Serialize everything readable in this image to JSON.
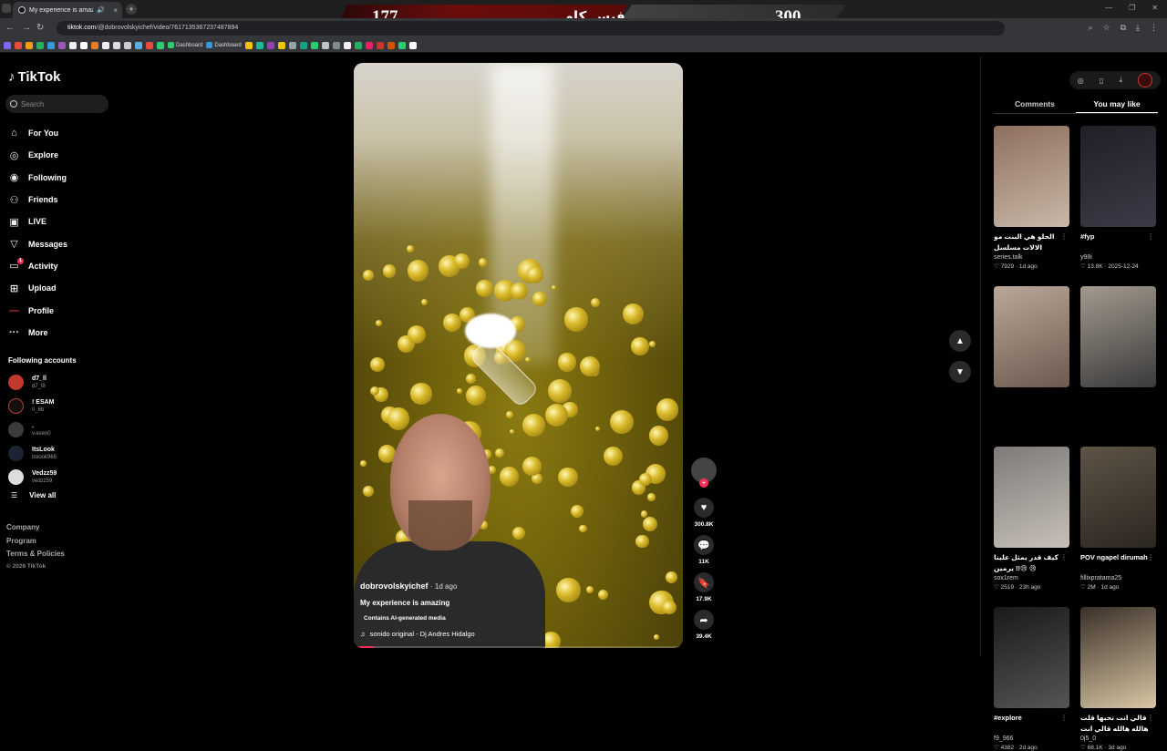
{
  "browser": {
    "tab_title": "My experience is amazing |",
    "url_domain": "tiktok.com",
    "url_path": "/@dobrovolskyichef/video/7617135367237487894",
    "bookmarks": [
      "Dashboard",
      "Dashboard"
    ]
  },
  "scoreboard": {
    "left_score": "177",
    "name": "فيس كام",
    "right_score": "300"
  },
  "tiktok": {
    "logo": "TikTok",
    "search_placeholder": "Search",
    "menu": [
      {
        "label": "For You",
        "icon": "home-icon"
      },
      {
        "label": "Explore",
        "icon": "compass-icon"
      },
      {
        "label": "Following",
        "icon": "following-icon"
      },
      {
        "label": "Friends",
        "icon": "friends-icon"
      },
      {
        "label": "LIVE",
        "icon": "live-icon"
      },
      {
        "label": "Messages",
        "icon": "messages-icon"
      },
      {
        "label": "Activity",
        "icon": "activity-icon",
        "badge": "1"
      },
      {
        "label": "Upload",
        "icon": "upload-icon"
      },
      {
        "label": "Profile",
        "icon": "profile-icon"
      },
      {
        "label": "More",
        "icon": "more-icon"
      }
    ],
    "following_title": "Following accounts",
    "accounts": [
      {
        "name": "d7_ll",
        "handle": "d7_l8"
      },
      {
        "name": "! ESAM",
        "handle": "0_6b"
      },
      {
        "name": ".",
        "handle": "v.exen0"
      },
      {
        "name": "ItsLook",
        "handle": "itslook965"
      },
      {
        "name": "Vedzz59",
        "handle": "vedzz59"
      }
    ],
    "view_all": "View all",
    "footer": [
      "Company",
      "Program",
      "Terms & Policies"
    ],
    "copyright": "© 2026 TikTok"
  },
  "video": {
    "username": "dobrovolskyichef",
    "posted": "· 1d ago",
    "description": "My experience is amazing",
    "ai_label": "Contains AI-generated media",
    "sound": "sonido original - Dj Andres Hidalgo",
    "progress": 0.06,
    "likes": "300.8K",
    "comments": "11K",
    "saves": "17.9K",
    "shares": "39.4K"
  },
  "right_panel": {
    "tabs": [
      "Comments",
      "You may like"
    ],
    "active_tab": "You may like",
    "cards": [
      {
        "title": "الحلو هي البنت مو الالات مسلسل #السيمشه ❤️ ...",
        "user": "series.talk",
        "likes": "7929",
        "date": "1d ago",
        "colors": [
          "#8e6f5e",
          "#c9b8a8"
        ]
      },
      {
        "title": "#fyp",
        "user": "y98i",
        "likes": "13.8K",
        "date": "2025-12-24",
        "colors": [
          "#1f1f26",
          "#3b3b48"
        ]
      },
      {
        "title": "",
        "user": "",
        "likes": "",
        "date": "",
        "colors": [
          "#b9a79a",
          "#6d5a4e"
        ]
      },
      {
        "title": "",
        "user": "",
        "likes": "",
        "date": "",
        "colors": [
          "#a39a8e",
          "#3a3a3a"
        ]
      },
      {
        "title": "كيف قدر يمثل علينا يرمين !!😢 😢 @Osama...",
        "user": "sox1rem",
        "likes": "2519",
        "date": "23h ago",
        "colors": [
          "#7d7a78",
          "#c7c0b8"
        ]
      },
      {
        "title": "POV ngapel dirumah",
        "user": "fillixpratama25",
        "likes": "2M",
        "date": "1d ago",
        "colors": [
          "#5e5446",
          "#2b2620"
        ]
      },
      {
        "title": "#explore",
        "user": "f9_966",
        "likes": "4382",
        "date": "2d ago",
        "colors": [
          "#1a1a1a",
          "#555"
        ]
      },
      {
        "title": "قالي انت تحبها قلت هالله هالله قالي انت تموت فيها",
        "user": "0j5_0",
        "likes": "68.1K",
        "date": "3d ago",
        "colors": [
          "#3a3028",
          "#d9c6a4"
        ]
      },
      {
        "title": "",
        "user": "",
        "likes": "",
        "date": "",
        "colors": [
          "#c9b29a",
          "#6c4e3d"
        ]
      },
      {
        "title": "",
        "user": "",
        "likes": "",
        "date": "",
        "colors": [
          "#9b86b8",
          "#d3c3e6"
        ]
      }
    ]
  },
  "colors": {
    "accent": "#fe2c55",
    "background": "#000000"
  }
}
